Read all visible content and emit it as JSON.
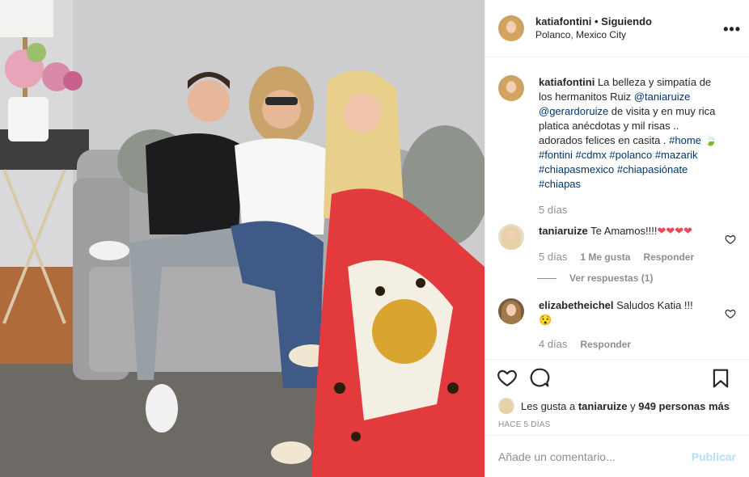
{
  "post": {
    "author": "katiafontini",
    "separator": "•",
    "follow_state": "Siguiendo",
    "location": "Polanco, Mexico City",
    "more_label": "•••"
  },
  "caption": {
    "user": "katiafontini",
    "text_1": " La belleza y simpatía de los hermanitos Ruiz ",
    "mention_1": "@taniaruize",
    "mention_2": "@gerardoruize",
    "text_2": " de visita y en muy rica platica anécdotas y mil risas .. adorados felices en casita . ",
    "hashtag_home": "#home",
    "leaf": "🍃",
    "hashtags": "#fontini #cdmx #polanco #mazarik #chiapasmexico #chiapasiónate #chiapas",
    "time": "5 días"
  },
  "comments": [
    {
      "user": "taniaruize",
      "text": " Te Amamos!!!!",
      "hearts": "❤❤❤❤",
      "time": "5 días",
      "likes": "1 Me gusta",
      "reply": "Responder",
      "view_replies": "Ver respuestas (1)"
    },
    {
      "user": "elizabetheichel",
      "text": " Saludos Katia !!!",
      "emoji": "😯",
      "time": "4 días",
      "reply": "Responder"
    }
  ],
  "likes": {
    "prefix": "Les gusta a ",
    "user": "taniaruize",
    "middle": " y ",
    "count": "949 personas más"
  },
  "posted_ago": "HACE 5 DÍAS",
  "add_comment": {
    "placeholder": "Añade un comentario...",
    "publish": "Publicar"
  },
  "colors": {
    "link": "#003569",
    "muted": "#8e8e8e",
    "publish_disabled": "#b2dffc",
    "heart_red": "#ed4956"
  }
}
